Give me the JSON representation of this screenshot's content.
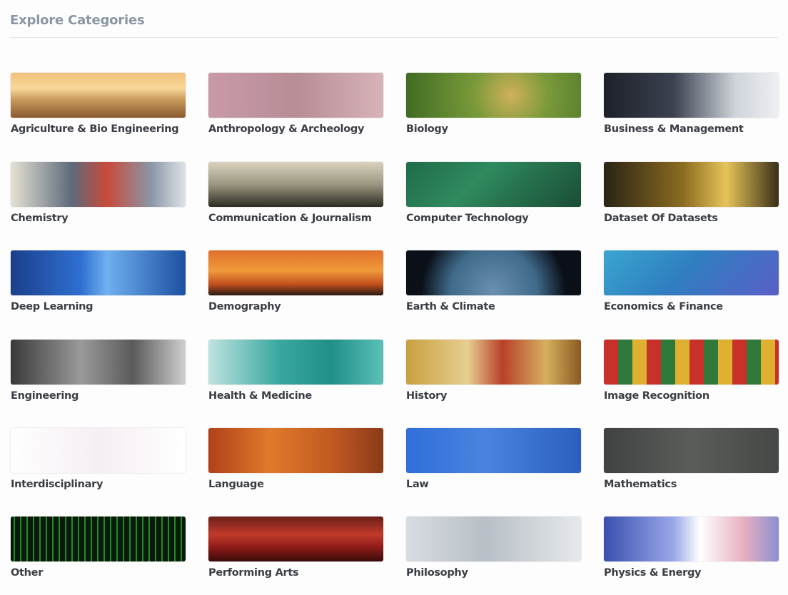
{
  "page": {
    "title": "Explore Categories"
  },
  "categories": [
    {
      "label": "Agriculture & Bio Engineering",
      "icon": "farm-field-image",
      "bg": "linear-gradient(180deg,#f2c27a 0%,#f7d79a 35%,#c79a5a 60%,#8a5a2f 100%)"
    },
    {
      "label": "Anthropology & Archeology",
      "icon": "terracotta-army-image",
      "bg": "linear-gradient(90deg,#c89aa6 0%,#b88d96 50%,#d7b3b8 100%)"
    },
    {
      "label": "Biology",
      "icon": "bee-on-flower-image",
      "bg": "radial-gradient(circle at 60% 50%,#d0b05a 0%,#7a9a3a 35%,#3f6b22 100%)"
    },
    {
      "label": "Business & Management",
      "icon": "handshake-image",
      "bg": "linear-gradient(90deg,#1c2028 0%,#3b4250 40%,#cfd4db 75%,#eef0f2 100%)"
    },
    {
      "label": "Chemistry",
      "icon": "lab-glassware-image",
      "bg": "linear-gradient(90deg,#e6e2d5 0%,#5d6a7a 35%,#c94a3a 55%,#8a96a6 80%,#dfe3e8 100%)"
    },
    {
      "label": "Communication & Journalism",
      "icon": "newspapers-image",
      "bg": "linear-gradient(180deg,#d9d3be 0%,#9b9680 50%,#2d2b22 100%)"
    },
    {
      "label": "Computer Technology",
      "icon": "circuit-board-image",
      "bg": "linear-gradient(135deg,#1f6b4a 0%,#2f8a5e 40%,#1a4d36 100%)"
    },
    {
      "label": "Dataset Of Datasets",
      "icon": "gold-hexagons-image",
      "bg": "linear-gradient(90deg,#2a2416 0%,#8a6b20 45%,#e6c45a 70%,#3a2f18 100%)"
    },
    {
      "label": "Deep Learning",
      "icon": "neural-network-image",
      "bg": "linear-gradient(90deg,#1a3f8a 0%,#2f6fd0 40%,#6fb0f0 55%,#1c4fa0 100%)"
    },
    {
      "label": "Demography",
      "icon": "crowd-silhouette-image",
      "bg": "linear-gradient(180deg,#e0702a 0%,#f09a3a 45%,#c2501e 75%,#2a1a12 100%)"
    },
    {
      "label": "Earth & Climate",
      "icon": "earth-globe-image",
      "bg": "radial-gradient(circle at 50% 90%,#6a8fb0 0%,#3f6a8a 45%,#0a0f18 75%)"
    },
    {
      "label": "Economics & Finance",
      "icon": "finance-graph-image",
      "bg": "linear-gradient(135deg,#3aa6d0 0%,#2f7fc0 45%,#5a5fc8 100%)"
    },
    {
      "label": "Engineering",
      "icon": "gears-image",
      "bg": "linear-gradient(90deg,#3a3a3a 0%,#9a9a9a 40%,#5a5a5a 70%,#d0d0d0 100%)"
    },
    {
      "label": "Health & Medicine",
      "icon": "surgeons-image",
      "bg": "linear-gradient(90deg,#bfe3e0 0%,#3aa8a0 40%,#1f8f88 70%,#5cc0b8 100%)"
    },
    {
      "label": "History",
      "icon": "fresco-painting-image",
      "bg": "linear-gradient(90deg,#c9a040 0%,#e6cf90 35%,#b9402a 55%,#d6b060 80%,#8a5a20 100%)"
    },
    {
      "label": "Image Recognition",
      "icon": "christmas-pattern-image",
      "bg": "repeating-linear-gradient(90deg,#c8302a 0 20px,#2f7a3a 20px 40px,#e0b030 40px 60px)"
    },
    {
      "label": "Interdisciplinary",
      "icon": "jellyfish-sketch-image",
      "bg": "linear-gradient(90deg,#ffffff 0%,#f6eef4 50%,#ffffff 100%)"
    },
    {
      "label": "Language",
      "icon": "chinese-characters-image",
      "bg": "linear-gradient(90deg,#b0401a 0%,#e07a2a 35%,#c25a22 70%,#8a3a18 100%)"
    },
    {
      "label": "Law",
      "icon": "lady-justice-image",
      "bg": "linear-gradient(90deg,#2f6fd8 0%,#4a84e0 45%,#2a5fc0 100%)"
    },
    {
      "label": "Mathematics",
      "icon": "chalkboard-equations-image",
      "bg": "linear-gradient(90deg,#3f4240 0%,#5a5d5a 50%,#454845 100%)"
    },
    {
      "label": "Other",
      "icon": "matrix-code-image",
      "bg": "repeating-linear-gradient(90deg,#0a1a0a 0 4px,#1f8a2a 4px 6px,#0a1a0a 6px 9px)"
    },
    {
      "label": "Performing Arts",
      "icon": "theater-stage-image",
      "bg": "linear-gradient(180deg,#6a1f1a 0%,#c23a2a 40%,#8a1a18 70%,#3a0c0a 100%)"
    },
    {
      "label": "Philosophy",
      "icon": "philosopher-statue-image",
      "bg": "linear-gradient(90deg,#d8dde2 0%,#b8bfc6 45%,#e6e9ec 100%)"
    },
    {
      "label": "Physics & Energy",
      "icon": "power-lines-image",
      "bg": "linear-gradient(90deg,#3a4fb0 0%,#9aa8e8 40%,#ffffff 55%,#e8b0c0 80%,#8a90d0 100%)"
    }
  ]
}
